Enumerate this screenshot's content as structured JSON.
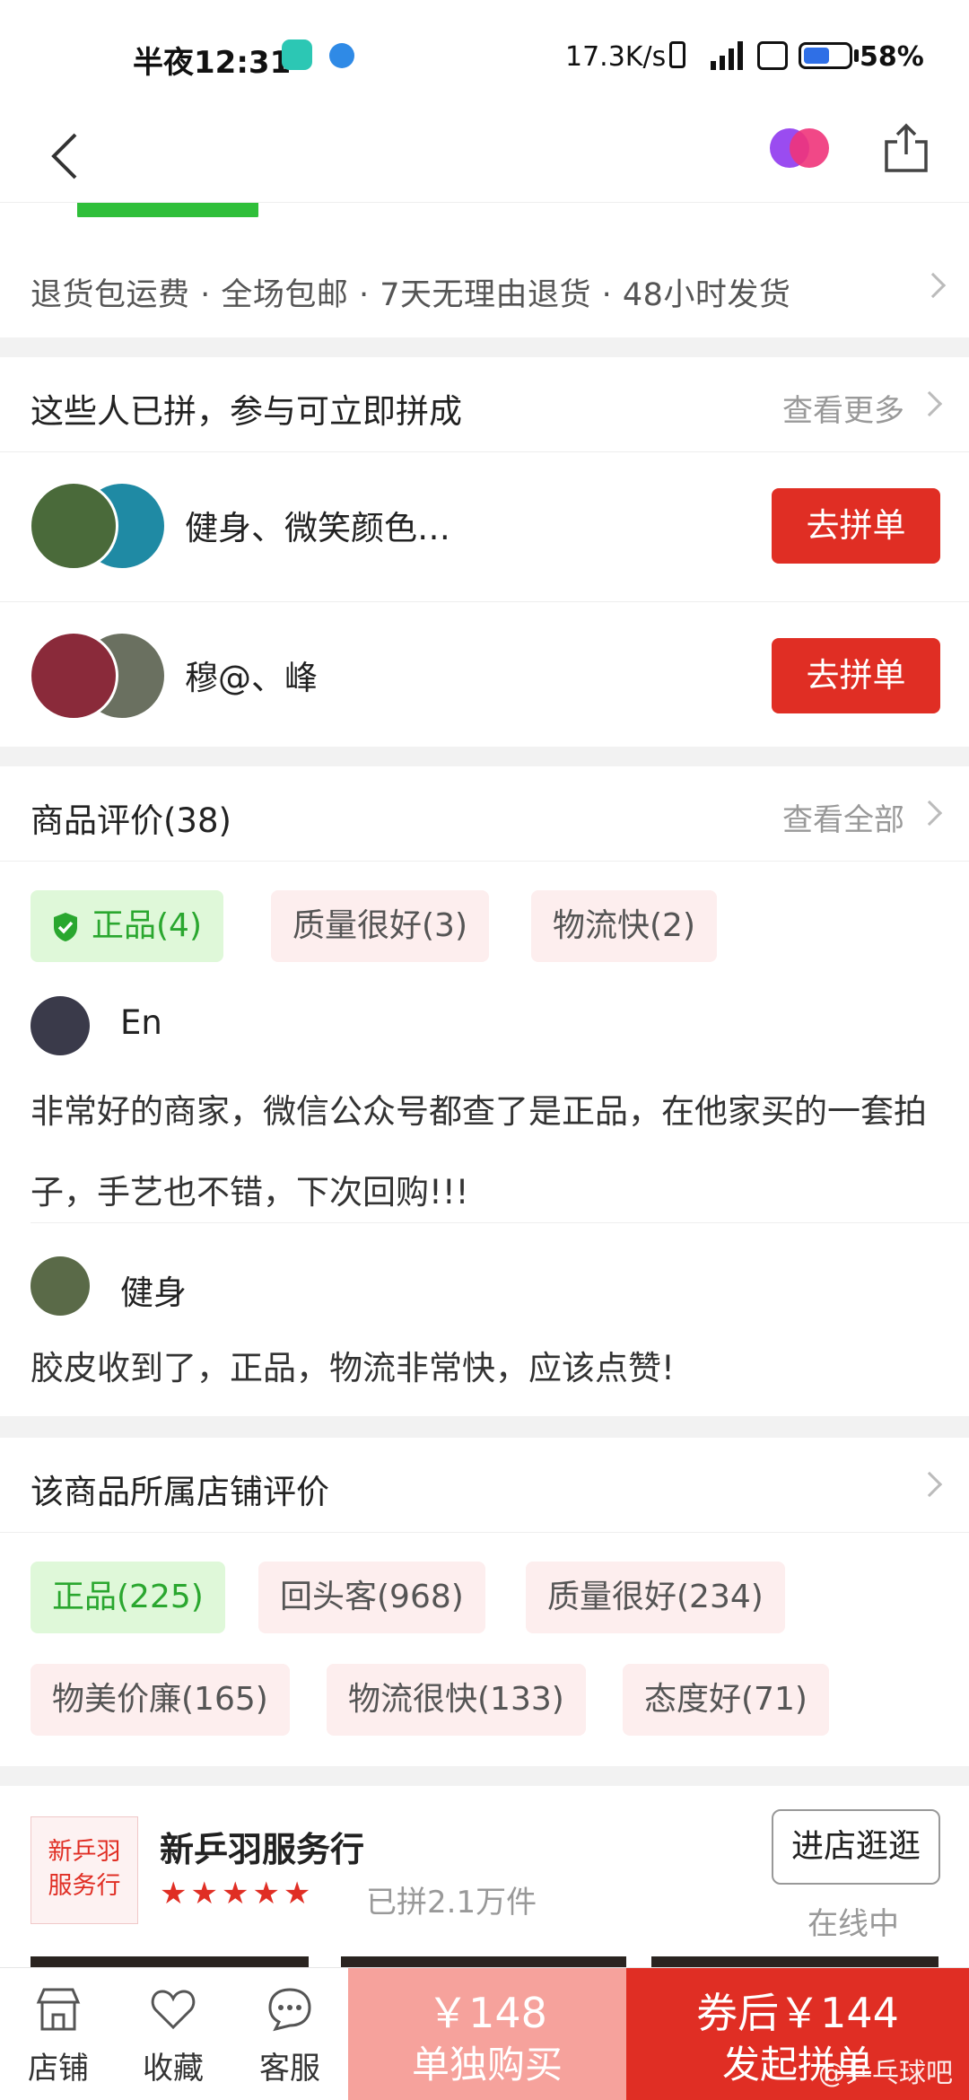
{
  "status_bar": {
    "time": "半夜12:31",
    "net_speed": "17.3K/s",
    "battery_pct": "58%",
    "battery_level": 0.58
  },
  "services": {
    "text": "退货包运费  ·  全场包邮  ·  7天无理由退货  ·  48小时发货"
  },
  "group_buy": {
    "title": "这些人已拼，参与可立即拼成",
    "more": "查看更多",
    "rows": [
      {
        "name": "健身、微笑颜色…",
        "button": "去拼单"
      },
      {
        "name": "穆@、峰",
        "button": "去拼单"
      }
    ]
  },
  "reviews": {
    "title": "商品评价(38)",
    "more": "查看全部",
    "tags": [
      "正品(4)",
      "质量很好(3)",
      "物流快(2)"
    ],
    "items": [
      {
        "user": "En",
        "text": "非常好的商家，微信公众号都查了是正品，在他家买的一套拍子，手艺也不错，下次回购!!!"
      },
      {
        "user": "健身",
        "text": "胶皮收到了，正品，物流非常快，应该点赞!"
      }
    ]
  },
  "store_reviews": {
    "title": "该商品所属店铺评价",
    "tags": [
      "正品(225)",
      "回头客(968)",
      "质量很好(234)",
      "物美价廉(165)",
      "物流很快(133)",
      "态度好(71)"
    ]
  },
  "store": {
    "logo_line1": "新乒羽",
    "logo_line2": "服务行",
    "name": "新乒羽服务行",
    "stars": "★★★★★",
    "rating": 5,
    "sold": "已拼2.1万件",
    "enter": "进店逛逛",
    "status": "在线中"
  },
  "bottom_bar": {
    "store": "店铺",
    "favorite": "收藏",
    "service": "客服",
    "solo_price": "￥148",
    "solo_label": "单独购买",
    "group_price": "券后￥144",
    "group_label": "发起拼单",
    "watermark": "@乒乓球吧"
  },
  "colors": {
    "brand_red": "#e02e24",
    "green": "#2aa72f",
    "solo_pink": "#f6a29c"
  }
}
